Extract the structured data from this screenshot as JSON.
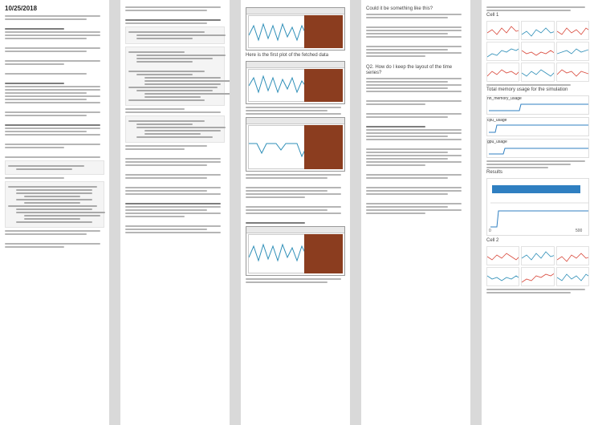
{
  "notes": {
    "date_title": "10/25/2018",
    "plot_caption_1": "Here is the first plot of the fetched data",
    "cell_prompt": "Could it be something like this?",
    "q_time_series": "Q2. How do I keep the layout of the time series?",
    "q_loss_plot": "Total memory usage for the simulation",
    "section_label": "Cell 1",
    "hist_label": "Results",
    "cell_label_2": "Cell 2",
    "axis_a": "0",
    "axis_b": "500",
    "series_1": "nn_memory_usage",
    "series_2": "cpu_usage",
    "series_3": "gpu_usage"
  },
  "colors": {
    "wave": "#2f8fb8",
    "brown_panel": "#8b3d1f",
    "bar_blue": "#2f7fc1",
    "red": "#d94a3d"
  }
}
